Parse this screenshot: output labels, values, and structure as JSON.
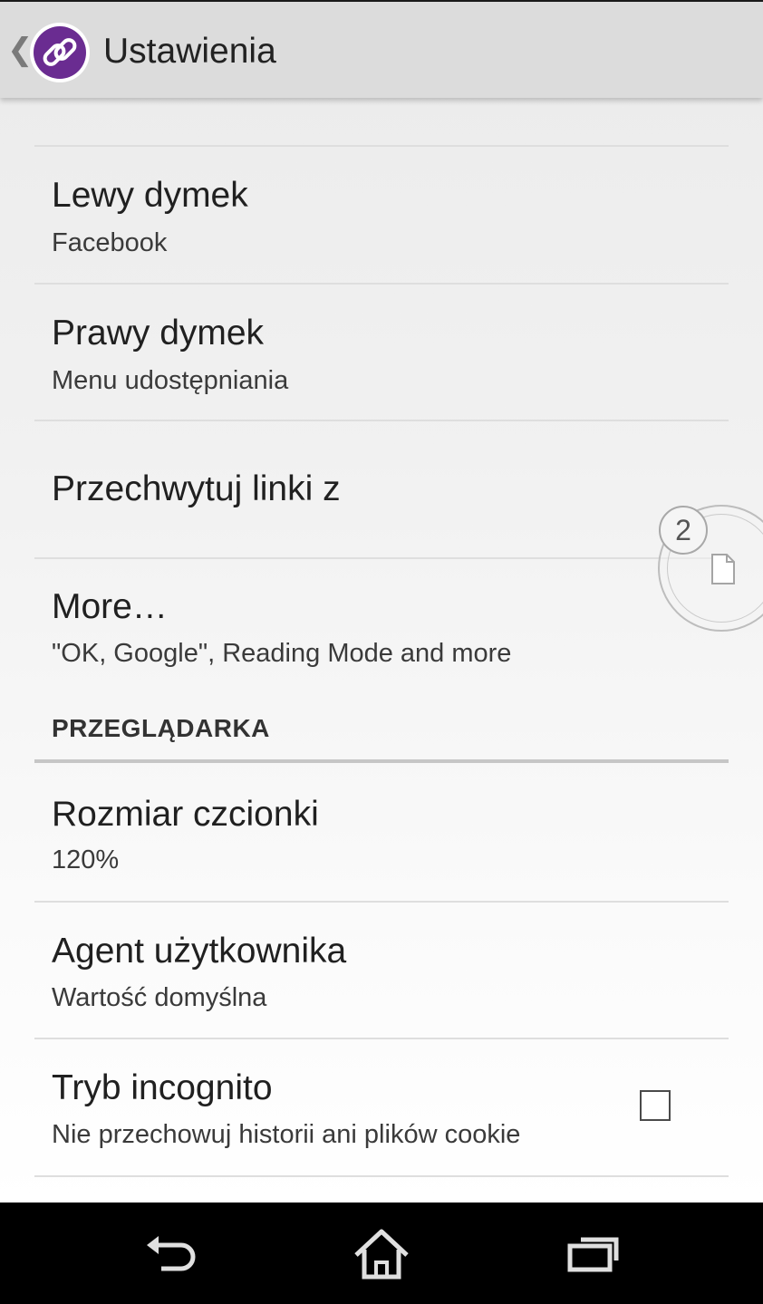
{
  "action_bar": {
    "back_icon": "chevron-left-icon",
    "app_icon": "link-icon",
    "title": "Ustawienia",
    "icon_color": "#6a2c91"
  },
  "settings": {
    "items": [
      {
        "title": "Lewy dymek",
        "summary": "Facebook"
      },
      {
        "title": "Prawy dymek",
        "summary": "Menu udostępniania"
      },
      {
        "title": "Przechwytuj linki z",
        "summary": ""
      },
      {
        "title": "More…",
        "summary": "\"OK, Google\", Reading Mode and more"
      }
    ],
    "browser_section": {
      "header": "PRZEGLĄDARKA",
      "items": [
        {
          "title": "Rozmiar czcionki",
          "summary": "120%"
        },
        {
          "title": "Agent użytkownika",
          "summary": "Wartość domyślna"
        },
        {
          "title": "Tryb incognito",
          "summary": "Nie przechowuj historii ani plików cookie",
          "checked": false
        }
      ]
    }
  },
  "bubble": {
    "count": "2",
    "icon": "document-icon"
  },
  "nav_bar": {
    "buttons": [
      "back-icon",
      "home-icon",
      "recent-apps-icon"
    ]
  }
}
